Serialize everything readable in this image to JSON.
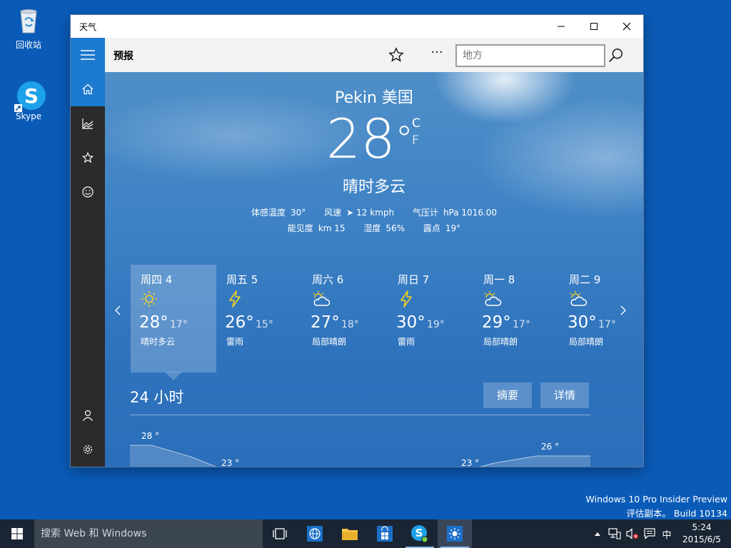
{
  "desktop": {
    "recycle_bin": "回收站",
    "skype": "Skype"
  },
  "window": {
    "title": "天气",
    "page_title": "预报",
    "search_placeholder": "地方"
  },
  "current": {
    "location": "Pekin 美国",
    "temp": "28",
    "degree": "°",
    "unit_c": "C",
    "unit_f": "F",
    "condition": "晴时多云",
    "details_row1": [
      {
        "label": "体感温度",
        "value": "30°"
      },
      {
        "label": "风速",
        "value": "12 kmph"
      },
      {
        "label": "气压计",
        "value": "hPa 1016.00"
      }
    ],
    "details_row2": [
      {
        "label": "能见度",
        "value": "km 15"
      },
      {
        "label": "湿度",
        "value": "56%"
      },
      {
        "label": "露点",
        "value": "19°"
      }
    ]
  },
  "forecast": [
    {
      "day": "周四 4",
      "hi": "28°",
      "lo": "17°",
      "cond": "晴时多云",
      "icon": "sun-icon"
    },
    {
      "day": "周五 5",
      "hi": "26°",
      "lo": "15°",
      "cond": "雷雨",
      "icon": "lightning-icon"
    },
    {
      "day": "周六 6",
      "hi": "27°",
      "lo": "18°",
      "cond": "局部晴朗",
      "icon": "partly-cloudy-icon"
    },
    {
      "day": "周日 7",
      "hi": "30°",
      "lo": "19°",
      "cond": "雷雨",
      "icon": "lightning-icon"
    },
    {
      "day": "周一 8",
      "hi": "29°",
      "lo": "17°",
      "cond": "局部晴朗",
      "icon": "partly-cloudy-icon"
    },
    {
      "day": "周二 9",
      "hi": "30°",
      "lo": "17°",
      "cond": "局部晴朗",
      "icon": "partly-cloudy-icon"
    }
  ],
  "hourly": {
    "title": "24 小时",
    "summary_label": "摘要",
    "detail_label": "详情",
    "labels": [
      "28 °",
      "23 °",
      "23 °",
      "26 °"
    ]
  },
  "watermark": {
    "line1": "Windows 10 Pro Insider Preview",
    "line2": "评估副本。 Build 10134"
  },
  "taskbar": {
    "search_text": "搜索 Web 和 Windows",
    "ime": "中",
    "time": "5:24",
    "date": "2015/6/5"
  },
  "colors": {
    "accent": "#1b79d0",
    "sidebar": "#2b2b2b",
    "desktop": "#0a5bb8",
    "taskbar": "#1a2533"
  }
}
